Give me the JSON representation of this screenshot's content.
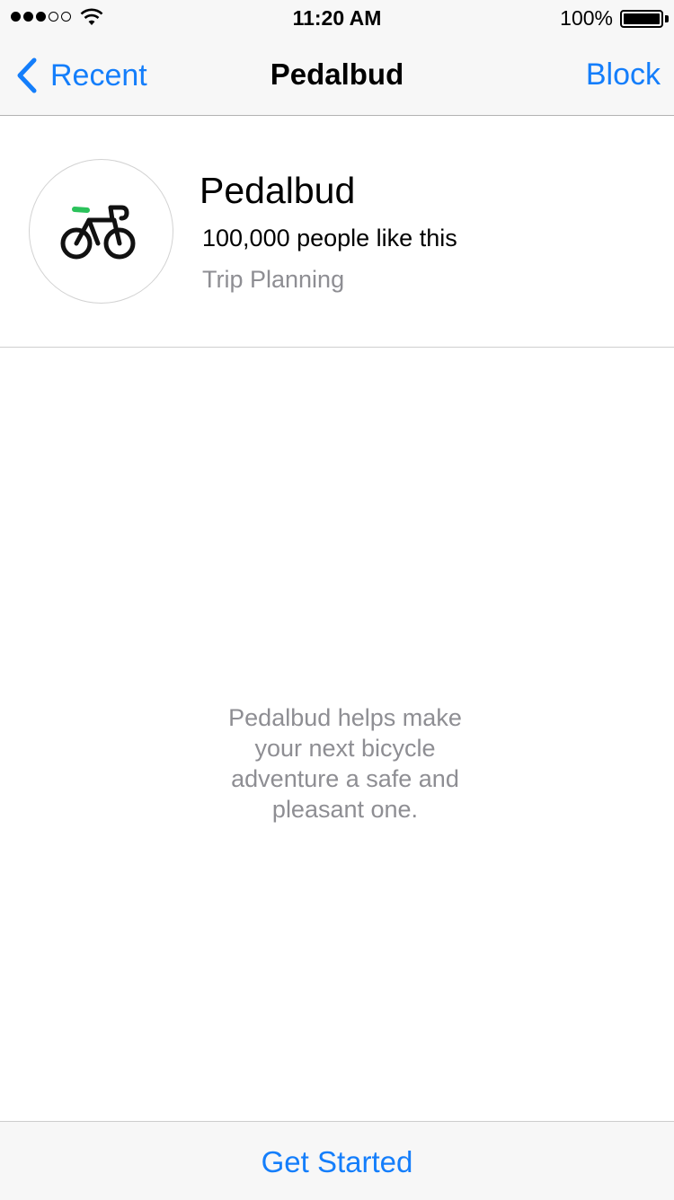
{
  "status_bar": {
    "time": "11:20 AM",
    "battery_percent": "100%",
    "signal_filled": 3,
    "signal_total": 5
  },
  "nav": {
    "back_label": "Recent",
    "title": "Pedalbud",
    "action_label": "Block",
    "accent_color": "#147efb"
  },
  "profile": {
    "name": "Pedalbud",
    "likes": "100,000 people like this",
    "category": "Trip Planning",
    "icon": "bicycle-icon",
    "icon_accent_color": "#2bc25b"
  },
  "description": "Pedalbud helps make your next bicycle adventure a safe and pleasant one.",
  "bottom_bar": {
    "button_label": "Get Started"
  }
}
